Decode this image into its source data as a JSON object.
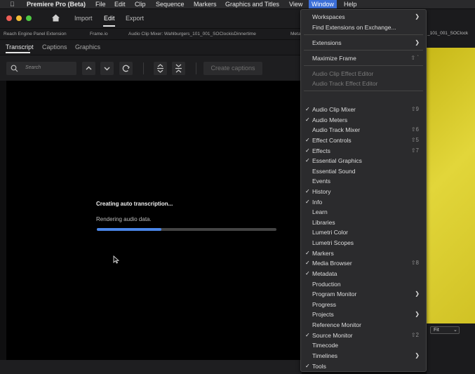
{
  "menubar": {
    "apple": "",
    "app": "Premiere Pro (Beta)",
    "items": [
      "File",
      "Edit",
      "Clip",
      "Sequence",
      "Markers",
      "Graphics and Titles",
      "View",
      "Window",
      "Help"
    ]
  },
  "nav": {
    "tabs": [
      "Import",
      "Edit",
      "Export"
    ],
    "active": "Edit"
  },
  "panels": [
    "Reach Engine Panel Extension",
    "Frame.io",
    "Audio Clip Mixer: Wahlburgers_101_001_SOClockisDinnertime",
    "Meta"
  ],
  "subtabs": [
    "Transcript",
    "Captions",
    "Graphics"
  ],
  "toolbar": {
    "search_placeholder": "Search",
    "create_captions": "Create captions"
  },
  "progress": {
    "title": "Creating auto transcription...",
    "status": "Rendering audio data.",
    "value": 0.36
  },
  "right": {
    "clip": "_101_001_SOClock",
    "fit": "Fit"
  },
  "menu": {
    "workspaces": "Workspaces",
    "find_ext": "Find Extensions on Exchange...",
    "extensions": "Extensions",
    "maximize": "Maximize Frame",
    "maximize_sc": "⇧ `",
    "audio_clip_effect": "Audio Clip Effect Editor",
    "audio_track_effect": "Audio Track Effect Editor",
    "items": [
      {
        "label": "Audio Clip Mixer",
        "checked": true,
        "sc": "⇧9"
      },
      {
        "label": "Audio Meters",
        "checked": true,
        "sc": ""
      },
      {
        "label": "Audio Track Mixer",
        "checked": false,
        "sc": "⇧6"
      },
      {
        "label": "Effect Controls",
        "checked": true,
        "sc": "⇧5"
      },
      {
        "label": "Effects",
        "checked": true,
        "sc": "⇧7"
      },
      {
        "label": "Essential Graphics",
        "checked": true,
        "sc": ""
      },
      {
        "label": "Essential Sound",
        "checked": false,
        "sc": ""
      },
      {
        "label": "Events",
        "checked": false,
        "sc": ""
      },
      {
        "label": "History",
        "checked": true,
        "sc": ""
      },
      {
        "label": "Info",
        "checked": true,
        "sc": ""
      },
      {
        "label": "Learn",
        "checked": false,
        "sc": ""
      },
      {
        "label": "Libraries",
        "checked": false,
        "sc": ""
      },
      {
        "label": "Lumetri Color",
        "checked": false,
        "sc": ""
      },
      {
        "label": "Lumetri Scopes",
        "checked": false,
        "sc": ""
      },
      {
        "label": "Markers",
        "checked": true,
        "sc": ""
      },
      {
        "label": "Media Browser",
        "checked": true,
        "sc": "⇧8"
      },
      {
        "label": "Metadata",
        "checked": true,
        "sc": ""
      },
      {
        "label": "Production",
        "checked": false,
        "sc": ""
      },
      {
        "label": "Program Monitor",
        "checked": false,
        "sc": "",
        "arrow": true
      },
      {
        "label": "Progress",
        "checked": false,
        "sc": ""
      },
      {
        "label": "Projects",
        "checked": false,
        "sc": "",
        "arrow": true
      },
      {
        "label": "Reference Monitor",
        "checked": false,
        "sc": ""
      },
      {
        "label": "Source Monitor",
        "checked": true,
        "sc": "⇧2"
      },
      {
        "label": "Timecode",
        "checked": false,
        "sc": ""
      },
      {
        "label": "Timelines",
        "checked": false,
        "sc": "",
        "arrow": true
      },
      {
        "label": "Tools",
        "checked": true,
        "sc": ""
      }
    ]
  },
  "colors": {
    "accent": "#3c6fd8",
    "progress": "#4a86e8",
    "yellow": "#d4c628"
  }
}
